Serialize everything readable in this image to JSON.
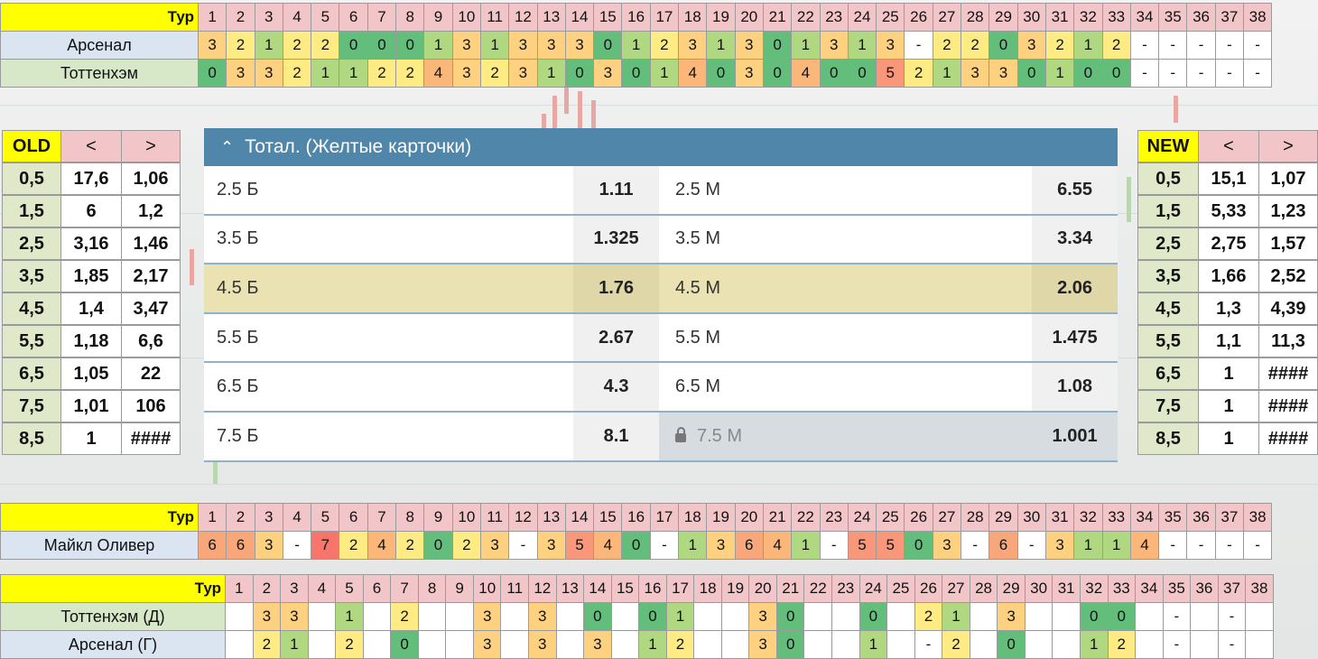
{
  "rounds": [
    "1",
    "2",
    "3",
    "4",
    "5",
    "6",
    "7",
    "8",
    "9",
    "10",
    "11",
    "12",
    "13",
    "14",
    "15",
    "16",
    "17",
    "18",
    "19",
    "20",
    "21",
    "22",
    "23",
    "24",
    "25",
    "26",
    "27",
    "28",
    "29",
    "30",
    "31",
    "32",
    "33",
    "34",
    "35",
    "36",
    "37",
    "38"
  ],
  "top_table": {
    "header_label": "Тур",
    "rows": [
      {
        "name": "Арсенал",
        "values": [
          "3",
          "2",
          "1",
          "2",
          "2",
          "0",
          "0",
          "0",
          "1",
          "3",
          "1",
          "3",
          "3",
          "3",
          "0",
          "1",
          "2",
          "3",
          "1",
          "3",
          "0",
          "1",
          "3",
          "1",
          "3",
          "-",
          "2",
          "2",
          "0",
          "3",
          "2",
          "1",
          "2",
          "-",
          "-",
          "-",
          "-",
          "-"
        ]
      },
      {
        "name": "Тоттенхэм",
        "values": [
          "0",
          "3",
          "3",
          "2",
          "1",
          "1",
          "2",
          "2",
          "4",
          "3",
          "2",
          "3",
          "1",
          "0",
          "3",
          "0",
          "1",
          "4",
          "0",
          "3",
          "0",
          "4",
          "0",
          "0",
          "5",
          "2",
          "1",
          "3",
          "3",
          "0",
          "1",
          "0",
          "0",
          "-",
          "-",
          "-",
          "-",
          "-"
        ]
      }
    ]
  },
  "old_table": {
    "title": "OLD",
    "col2": "<",
    "col3": ">",
    "rows": [
      [
        "0,5",
        "17,6",
        "1,06"
      ],
      [
        "1,5",
        "6",
        "1,2"
      ],
      [
        "2,5",
        "3,16",
        "1,46"
      ],
      [
        "3,5",
        "1,85",
        "2,17"
      ],
      [
        "4,5",
        "1,4",
        "3,47"
      ],
      [
        "5,5",
        "1,18",
        "6,6"
      ],
      [
        "6,5",
        "1,05",
        "22"
      ],
      [
        "7,5",
        "1,01",
        "106"
      ],
      [
        "8,5",
        "1",
        "####"
      ]
    ]
  },
  "new_table": {
    "title": "NEW",
    "col2": "<",
    "col3": ">",
    "rows": [
      [
        "0,5",
        "15,1",
        "1,07"
      ],
      [
        "1,5",
        "5,33",
        "1,23"
      ],
      [
        "2,5",
        "2,75",
        "1,57"
      ],
      [
        "3,5",
        "1,66",
        "2,52"
      ],
      [
        "4,5",
        "1,3",
        "4,39"
      ],
      [
        "5,5",
        "1,1",
        "11,3"
      ],
      [
        "6,5",
        "1",
        "####"
      ],
      [
        "7,5",
        "1",
        "####"
      ],
      [
        "8,5",
        "1",
        "####"
      ]
    ]
  },
  "widget": {
    "title": "Тотал. (Желтые карточки)",
    "rows": [
      {
        "over_label": "2.5 Б",
        "over_odds": "1.11",
        "under_label": "2.5 М",
        "under_odds": "6.55"
      },
      {
        "over_label": "3.5 Б",
        "over_odds": "1.325",
        "under_label": "3.5 М",
        "under_odds": "3.34"
      },
      {
        "over_label": "4.5 Б",
        "over_odds": "1.76",
        "under_label": "4.5 М",
        "under_odds": "2.06"
      },
      {
        "over_label": "5.5 Б",
        "over_odds": "2.67",
        "under_label": "5.5 М",
        "under_odds": "1.475"
      },
      {
        "over_label": "6.5 Б",
        "over_odds": "4.3",
        "under_label": "6.5 М",
        "under_odds": "1.08"
      },
      {
        "over_label": "7.5 Б",
        "over_odds": "8.1",
        "under_label": "7.5 М",
        "under_odds": "1.001"
      }
    ],
    "highlight_index": 2,
    "locked_index": 5
  },
  "referee_table": {
    "header_label": "Тур",
    "name": "Майкл Оливер",
    "values": [
      "6",
      "6",
      "3",
      "-",
      "7",
      "2",
      "4",
      "2",
      "0",
      "2",
      "3",
      "-",
      "3",
      "5",
      "4",
      "0",
      "-",
      "1",
      "3",
      "6",
      "4",
      "1",
      "-",
      "5",
      "5",
      "0",
      "3",
      "-",
      "6",
      "-",
      "3",
      "1",
      "1",
      "4",
      "-",
      "-",
      "-",
      "-"
    ]
  },
  "bottom_table": {
    "header_label": "Тур",
    "rows": [
      {
        "name": "Тоттенхэм (Д)",
        "values": [
          "",
          "3",
          "3",
          "",
          "1",
          "",
          "2",
          "",
          "",
          "3",
          "",
          "3",
          "",
          "0",
          "",
          "0",
          "1",
          "",
          "",
          "3",
          "0",
          "",
          "",
          "0",
          "",
          "2",
          "1",
          "",
          "3",
          "",
          "",
          "0",
          "0",
          "",
          "-",
          "",
          "-",
          ""
        ]
      },
      {
        "name": "Арсенал (Г)",
        "values": [
          "",
          "2",
          "1",
          "",
          "2",
          "",
          "0",
          "",
          "",
          "3",
          "",
          "3",
          "",
          "3",
          "",
          "1",
          "2",
          "",
          "",
          "3",
          "0",
          "",
          "",
          "1",
          "",
          "-",
          "2",
          "",
          "0",
          "",
          "",
          "1",
          "2",
          "",
          "-",
          "",
          "-",
          ""
        ]
      }
    ]
  }
}
